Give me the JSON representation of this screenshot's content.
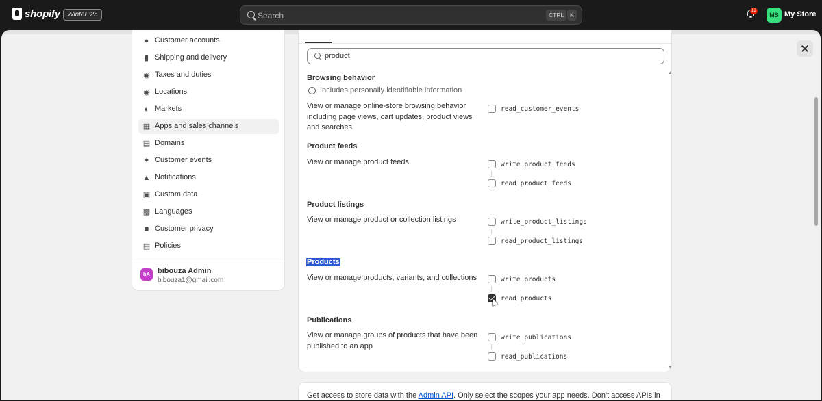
{
  "topbar": {
    "logo_text": "shopify",
    "edition_badge": "Winter '25",
    "search_placeholder": "Search",
    "shortcut_ctrl": "CTRL",
    "shortcut_key": "K",
    "notification_count": "12",
    "store_initials": "MS",
    "store_name": "My Store"
  },
  "sidebar": {
    "items": [
      {
        "label": "Customer accounts",
        "icon": "person-icon"
      },
      {
        "label": "Shipping and delivery",
        "icon": "truck-icon"
      },
      {
        "label": "Taxes and duties",
        "icon": "tax-icon"
      },
      {
        "label": "Locations",
        "icon": "location-pin-icon"
      },
      {
        "label": "Markets",
        "icon": "globe-icon"
      },
      {
        "label": "Apps and sales channels",
        "icon": "apps-icon",
        "active": true
      },
      {
        "label": "Domains",
        "icon": "domain-icon"
      },
      {
        "label": "Customer events",
        "icon": "sparkle-icon"
      },
      {
        "label": "Notifications",
        "icon": "bell-icon"
      },
      {
        "label": "Custom data",
        "icon": "data-icon"
      },
      {
        "label": "Languages",
        "icon": "language-icon"
      },
      {
        "label": "Customer privacy",
        "icon": "lock-icon"
      },
      {
        "label": "Policies",
        "icon": "policy-icon"
      }
    ],
    "user": {
      "initials": "bA",
      "name": "bibouza Admin",
      "email": "bibouza1@gmail.com"
    }
  },
  "scopes": {
    "filter_value": "product",
    "pii_note": "Includes personally identifiable information",
    "sections": [
      {
        "title": "Browsing behavior",
        "description": "View or manage online-store browsing behavior including page views, cart updates, product views and searches",
        "scopes": [
          {
            "label": "read_customer_events",
            "checked": false
          }
        ]
      },
      {
        "title": "Product feeds",
        "description": "View or manage product feeds",
        "scopes": [
          {
            "label": "write_product_feeds",
            "checked": false
          },
          {
            "label": "read_product_feeds",
            "checked": false
          }
        ]
      },
      {
        "title": "Product listings",
        "description": "View or manage product or collection listings",
        "scopes": [
          {
            "label": "write_product_listings",
            "checked": false
          },
          {
            "label": "read_product_listings",
            "checked": false
          }
        ]
      },
      {
        "title": "Products",
        "description": "View or manage products, variants, and collections",
        "scopes": [
          {
            "label": "write_products",
            "checked": false
          },
          {
            "label": "read_products",
            "checked": true
          }
        ]
      },
      {
        "title": "Publications",
        "description": "View or manage groups of products that have been published to an app",
        "scopes": [
          {
            "label": "write_publications",
            "checked": false
          },
          {
            "label": "read_publications",
            "checked": false
          }
        ]
      }
    ]
  },
  "info": {
    "prefix": "Get access to store data with the ",
    "link_text": "Admin API",
    "suffix": ". Only select the scopes your app needs. Don't access APIs in"
  }
}
